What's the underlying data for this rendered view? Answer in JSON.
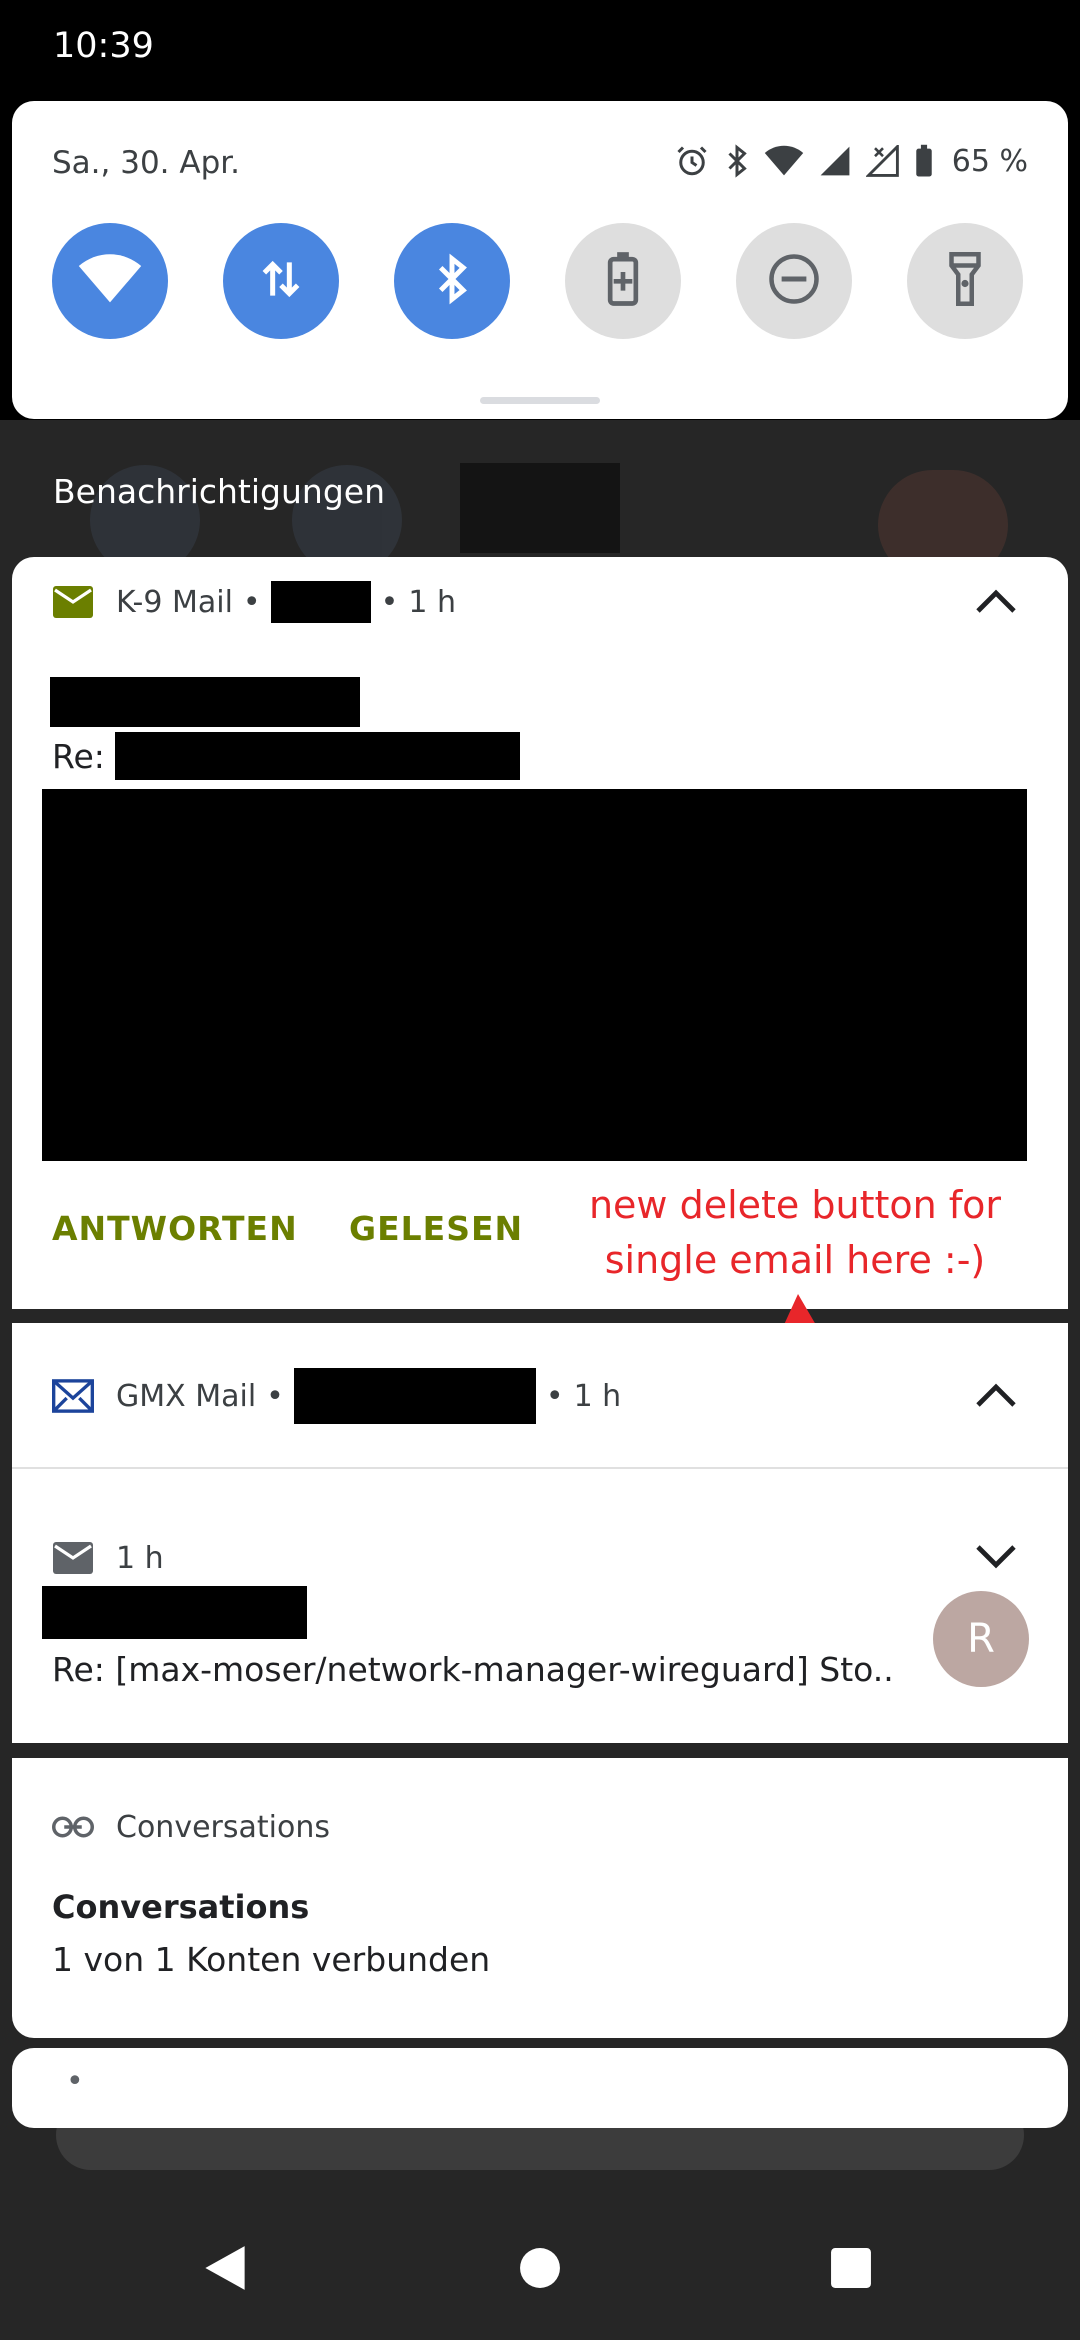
{
  "status_bar": {
    "time": "10:39"
  },
  "quick_settings": {
    "date": "Sa., 30. Apr.",
    "battery_percent": "65 %",
    "tiles": [
      {
        "name": "wifi",
        "active": true
      },
      {
        "name": "mobile-data",
        "active": true
      },
      {
        "name": "bluetooth",
        "active": true
      },
      {
        "name": "battery-saver",
        "active": false
      },
      {
        "name": "do-not-disturb",
        "active": false
      },
      {
        "name": "flashlight",
        "active": false
      }
    ]
  },
  "notifications_header": "Benachrichtigungen",
  "k9": {
    "app_name": "K-9 Mail",
    "separator": "•",
    "time": "1 h",
    "subject_prefix": "Re:",
    "actions": [
      "ANTWORTEN",
      "GELESEN"
    ],
    "icon": "envelope-icon"
  },
  "annotation": {
    "line1": "new delete button for",
    "line2": "single email here :-)"
  },
  "gmx": {
    "app_name": "GMX Mail",
    "separator": "•",
    "time": "1 h",
    "message_time": "1 h",
    "subject": "Re: [max-moser/network-manager-wireguard] Sto..",
    "avatar_letter": "R"
  },
  "conversations": {
    "app_name": "Conversations",
    "title": "Conversations",
    "text": "1 von 1 Konten verbunden"
  },
  "bottom_card": {
    "text": "•"
  },
  "colors": {
    "accent_blue": "#4a86e0",
    "k9_green": "#6b7f00",
    "annotation_red": "#e8262a"
  }
}
